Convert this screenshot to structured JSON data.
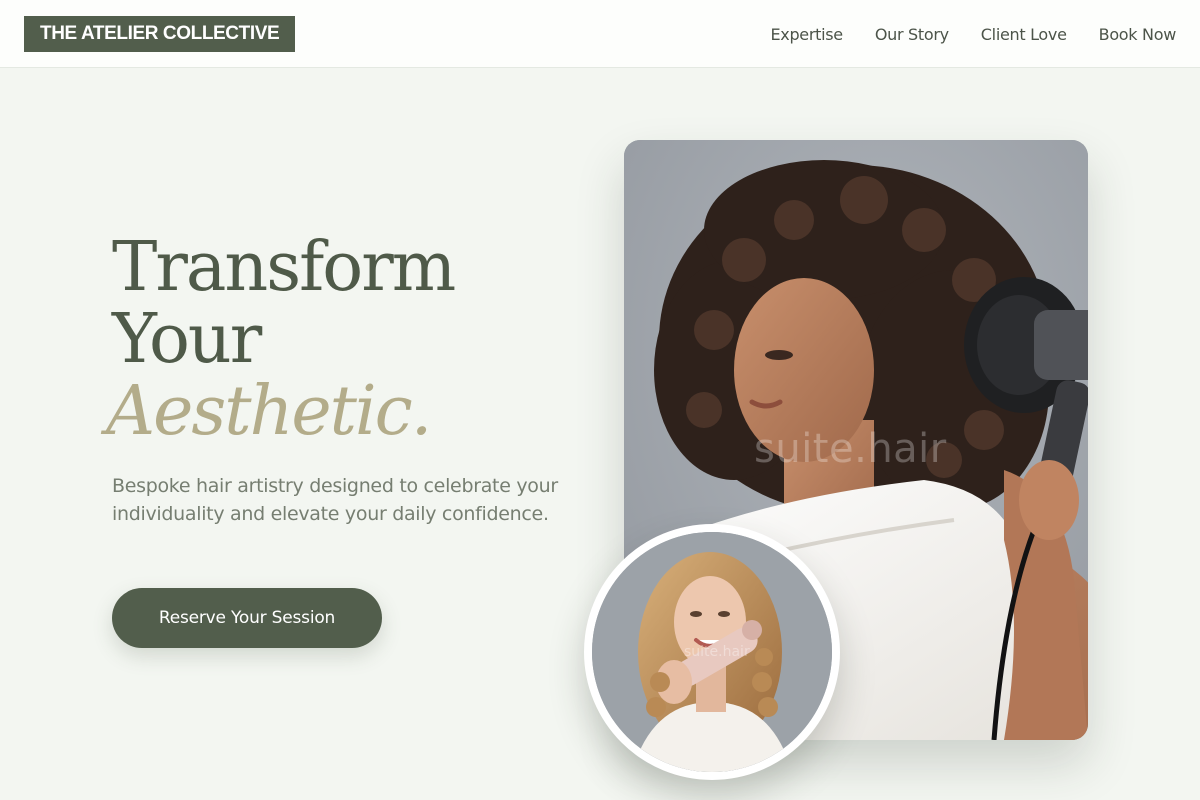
{
  "brand": {
    "name": "THE ATELIER COLLECTIVE"
  },
  "nav": {
    "items": [
      {
        "label": "Expertise"
      },
      {
        "label": "Our Story"
      },
      {
        "label": "Client Love"
      },
      {
        "label": "Book Now"
      }
    ]
  },
  "hero": {
    "headline_line1": "Transform",
    "headline_line2": "Your",
    "headline_accent": "Aesthetic.",
    "subtext": "Bespoke hair artistry designed to celebrate your individuality and elevate your daily confidence.",
    "cta_label": "Reserve Your Session",
    "main_image_watermark": "suite.hair",
    "secondary_image_watermark": "suite.hair"
  },
  "colors": {
    "brand_green": "#525e4c",
    "accent_gold": "#b3ac8a",
    "page_background": "#f3f6f1"
  }
}
